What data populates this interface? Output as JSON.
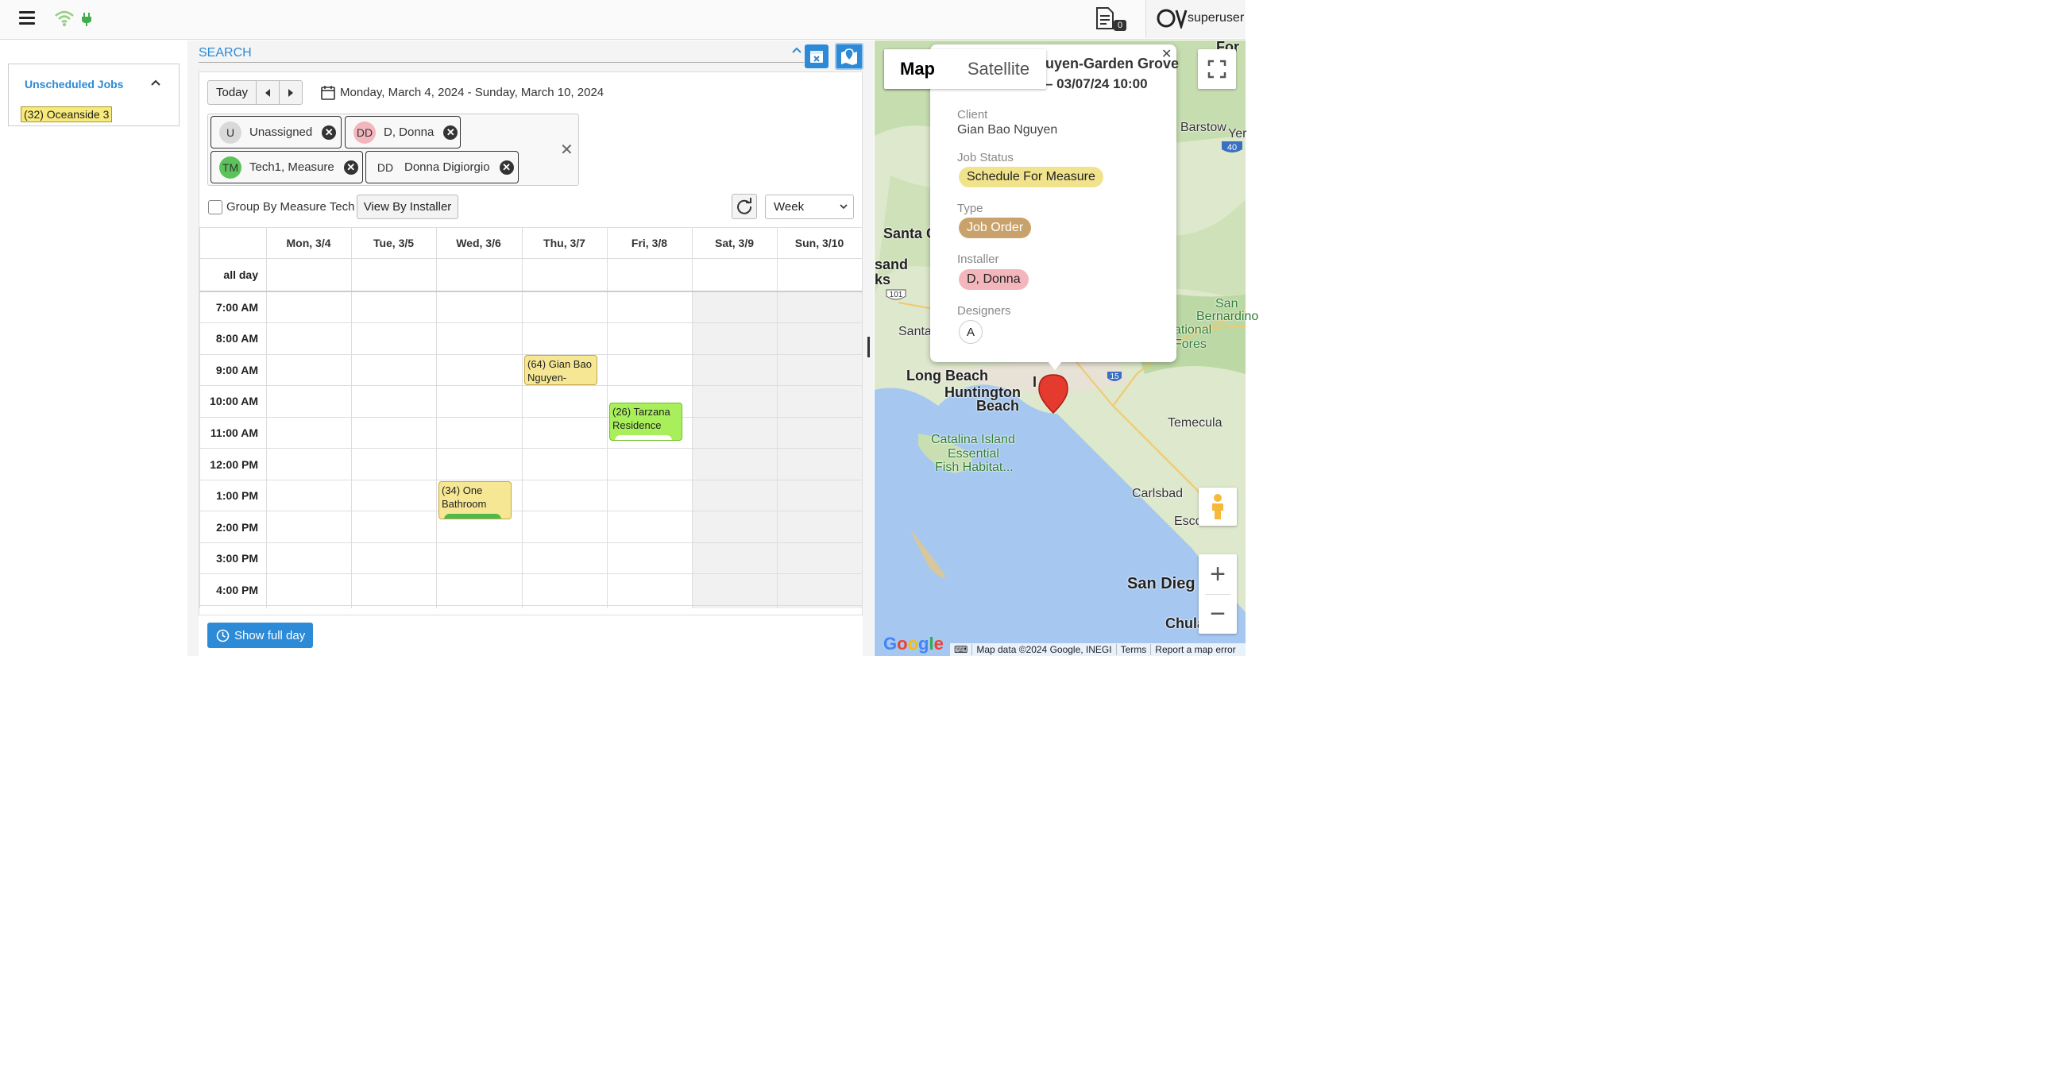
{
  "header": {
    "menu_icon": "hamburger-icon",
    "wifi_icon": "wifi-icon",
    "plug_icon": "plug-icon",
    "docs_icon": "document-icon",
    "docs_badge": "0",
    "user_name": "superuser"
  },
  "sidebar": {
    "title": "Unscheduled Jobs",
    "jobs": [
      "(32) Oceanside 3"
    ]
  },
  "search": {
    "label": "SEARCH"
  },
  "toolbar": {
    "today": "Today",
    "date_range": "Monday, March 4, 2024 - Sunday, March 10, 2024",
    "filters": [
      {
        "initials": "U",
        "name": "Unassigned",
        "color": "#d9d9d9"
      },
      {
        "initials": "DD",
        "name": "D, Donna",
        "color": "#f4b6bd"
      },
      {
        "initials": "TM",
        "name": "Tech1, Measure",
        "color": "#5cc35c"
      },
      {
        "initials": "DD",
        "name": "Donna Digiorgio",
        "color": "#f8f8f8"
      }
    ],
    "group_by_label": "Group By Measure Tech",
    "view_by_installer": "View By Installer",
    "view_select": "Week"
  },
  "calendar": {
    "days": [
      "Mon, 3/4",
      "Tue, 3/5",
      "Wed, 3/6",
      "Thu, 3/7",
      "Fri, 3/8",
      "Sat, 3/9",
      "Sun, 3/10"
    ],
    "all_day_label": "all day",
    "times": [
      "7:00 AM",
      "8:00 AM",
      "9:00 AM",
      "10:00 AM",
      "11:00 AM",
      "12:00 PM",
      "1:00 PM",
      "2:00 PM",
      "3:00 PM",
      "4:00 PM"
    ],
    "events": [
      {
        "title": "(64) Gian Bao Nguyen-",
        "day": "Thu, 3/7",
        "start": "9:00 AM",
        "color": "#f6e794"
      },
      {
        "title": "(26) Tarzana Residence",
        "day": "Fri, 3/8",
        "start": "10:00 AM",
        "color": "#a8ef5b"
      },
      {
        "title": "(34) One Bathroom",
        "day": "Wed, 3/6",
        "start": "1:00 PM",
        "color": "#f6e794"
      }
    ],
    "show_full_day": "Show full day"
  },
  "map": {
    "type_map": "Map",
    "type_satellite": "Satellite",
    "places": [
      "Barstow",
      "Yer",
      "Santa C",
      "sand",
      "ks",
      "Santa",
      "Long Beach",
      "Huntington",
      "Beach",
      "Catalina Island",
      "Essential",
      "Fish Habitat...",
      "San",
      "Bernardino",
      "ational Fores",
      "Temecula",
      "Carlsbad",
      "Escondi",
      "San Dieg",
      "Chula V",
      "For",
      "I"
    ],
    "highway_labels": [
      "40",
      "101",
      "15"
    ],
    "footer": {
      "data": "Map data ©2024 Google, INEGI",
      "terms": "Terms",
      "report": "Report a map error"
    },
    "google": "Google"
  },
  "info_window": {
    "title": "uyen-Garden Grove",
    "subtitle": "– 03/07/24 10:00",
    "client_label": "Client",
    "client": "Gian Bao Nguyen",
    "status_label": "Job Status",
    "status": "Schedule For Measure",
    "type_label": "Type",
    "type": "Job Order",
    "installer_label": "Installer",
    "installer": "D, Donna",
    "designers_label": "Designers",
    "designer": "A",
    "colors": {
      "status": "#f1e38c",
      "type": "#c9a26b",
      "installer": "#f4b6bd"
    }
  }
}
